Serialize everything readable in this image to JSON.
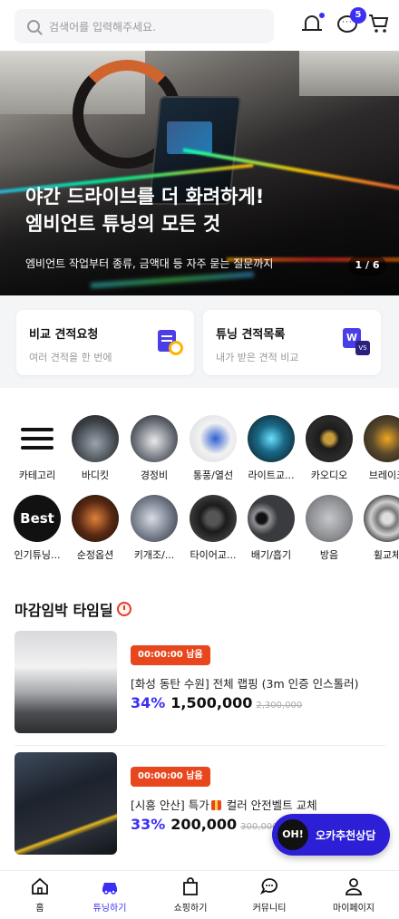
{
  "header": {
    "search_placeholder": "검색어를 입력해주세요.",
    "chat_badge": "5",
    "chat_icon_text": "···"
  },
  "hero": {
    "title_line1": "야간 드라이브를 더 화려하게!",
    "title_line2": "엠비언트 튜닝의 모든 것",
    "subtitle": "엠비언트 작업부터 종류, 금액대 등 자주 묻는 질문까지",
    "pager": "1 / 6"
  },
  "quotes": [
    {
      "title": "비교 견적요청",
      "desc": "여러 견적을 한 번에"
    },
    {
      "title": "튜닝 견적목록",
      "desc": "내가 받은 견적 비교",
      "icon_main": "W",
      "icon_sub": "VS"
    }
  ],
  "categories_row1": [
    {
      "label": "카테고리",
      "icon": "menu-icon"
    },
    {
      "label": "바디킷"
    },
    {
      "label": "경정비"
    },
    {
      "label": "통풍/열선"
    },
    {
      "label": "라이트교..."
    },
    {
      "label": "카오디오"
    },
    {
      "label": "브레이크"
    }
  ],
  "categories_row2": [
    {
      "label": "인기튜닝...",
      "icon_text": "Best"
    },
    {
      "label": "순정옵션"
    },
    {
      "label": "키개조/..."
    },
    {
      "label": "타이어교..."
    },
    {
      "label": "배기/흡기"
    },
    {
      "label": "방음"
    },
    {
      "label": "휠교체"
    }
  ],
  "deals": {
    "title": "마감임박 타임딜",
    "items": [
      {
        "timer": "00:00:00 남음",
        "name": "[화성 동탄 수원] 전체 랩핑 (3m 인증 인스톨러)",
        "rate": "34%",
        "price": "1,500,000",
        "original": "2,300,000"
      },
      {
        "timer": "00:00:00 남음",
        "name_prefix": "[시흥 안산] 특가",
        "name_suffix": "컬러 안전벨트 교체",
        "rate": "33%",
        "price": "200,000",
        "original": "300,000"
      }
    ]
  },
  "fab": {
    "badge": "OH!",
    "label": "오카추천상담"
  },
  "bottom_nav": [
    {
      "label": "홈"
    },
    {
      "label": "튜닝하기"
    },
    {
      "label": "쇼핑하기"
    },
    {
      "label": "커뮤니티"
    },
    {
      "label": "마이페이지"
    }
  ],
  "colors": {
    "accent": "#3b2ff5",
    "timer": "#e8461d",
    "fab": "#2c1fd6"
  }
}
